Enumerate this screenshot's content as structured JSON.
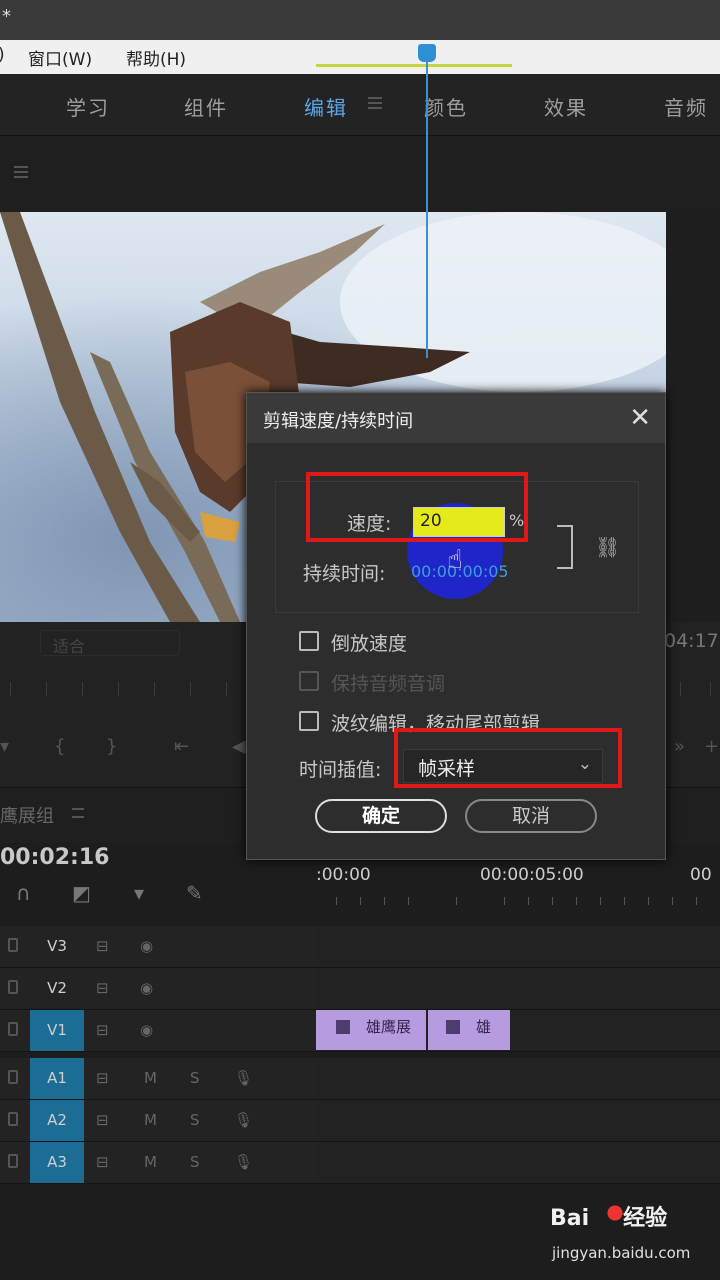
{
  "titlebar": {
    "mark": "*"
  },
  "menu": {
    "items": [
      ")",
      "窗口(W)",
      "帮助(H)"
    ]
  },
  "workspaces": {
    "tabs": [
      {
        "label": "学习",
        "active": false
      },
      {
        "label": "组件",
        "active": false
      },
      {
        "label": "编辑",
        "active": true
      },
      {
        "label": "颜色",
        "active": false
      },
      {
        "label": "效果",
        "active": false
      },
      {
        "label": "音频",
        "active": false
      }
    ]
  },
  "program_monitor": {
    "fit_label": "适合",
    "timecode_right": "04:17"
  },
  "sequence": {
    "name": "鹰展组",
    "current_time": "00:02:16",
    "ruler_labels": [
      ":00:00",
      "00:00:05:00",
      "00"
    ]
  },
  "tracks": {
    "video": [
      {
        "name": "V3",
        "selected": false
      },
      {
        "name": "V2",
        "selected": false
      },
      {
        "name": "V1",
        "selected": true
      }
    ],
    "audio": [
      {
        "name": "A1",
        "m": "M",
        "s": "S"
      },
      {
        "name": "A2",
        "m": "M",
        "s": "S"
      },
      {
        "name": "A3",
        "m": "M",
        "s": "S"
      }
    ]
  },
  "clips": {
    "v1_first": "雄鹰展",
    "v1_second": "雄"
  },
  "dialog": {
    "title": "剪辑速度/持续时间",
    "speed_label": "速度:",
    "speed_value": "20",
    "percent": "%",
    "duration_label": "持续时间:",
    "duration_value": "00:00:00:05",
    "reverse_label": "倒放速度",
    "audio_pitch_label": "保持音频音调",
    "ripple_label": "波纹编辑，移动尾部剪辑",
    "interp_label": "时间插值:",
    "interp_value": "帧采样",
    "ok_label": "确定",
    "cancel_label": "取消"
  },
  "watermark": {
    "brand": "Bai",
    "brand_suffix": "经验",
    "url": "jingyan.baidu.com"
  },
  "colors": {
    "accent": "#5aa7e6",
    "highlight_box": "#e01818",
    "clip": "#b79be0",
    "speed_field": "#e5ea1c"
  }
}
